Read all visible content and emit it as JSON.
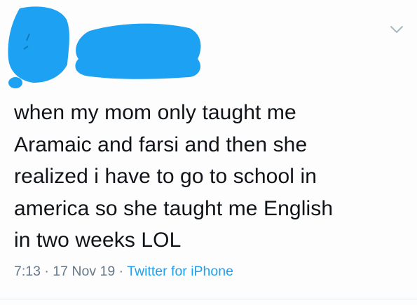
{
  "tweet": {
    "text_lines": [
      "when my mom only taught me",
      "Aramaic and farsi and then she",
      "realized i have to go to school in",
      "america so she taught me English",
      "in two weeks LOL"
    ],
    "time": "7:13",
    "date": "17 Nov 19",
    "source": "Twitter for iPhone",
    "separator": "·",
    "menu_icon": "chevron-down-icon",
    "redaction_color": "#1da1f2"
  }
}
